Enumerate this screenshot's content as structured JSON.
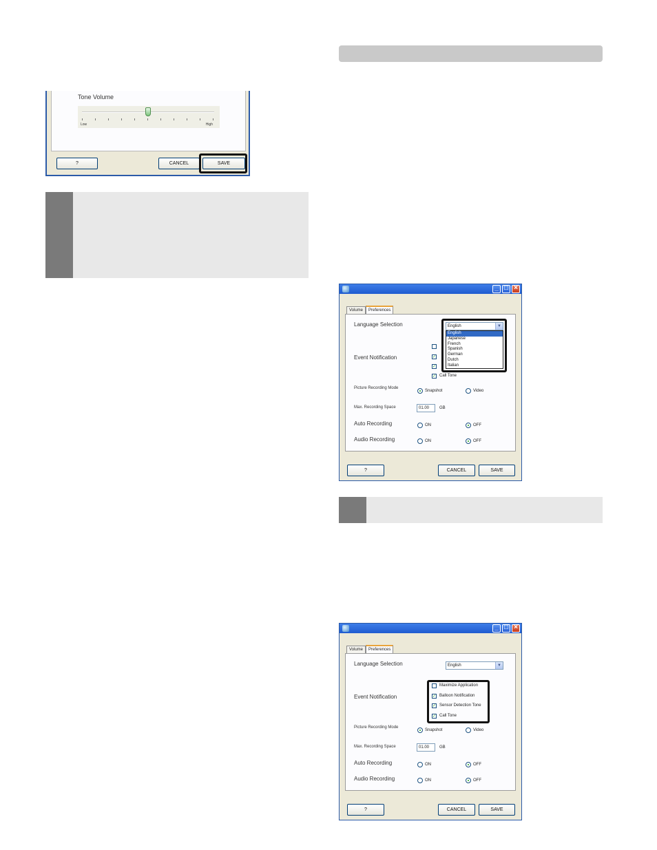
{
  "top_dialog": {
    "tone_volume_label": "Tone Volume",
    "slider_low": "Low",
    "slider_high": "High",
    "slider_level_fraction": 0.5,
    "help_button": "?",
    "cancel_button": "CANCEL",
    "save_button": "SAVE"
  },
  "dialog_tabs": {
    "volume": "Volume",
    "preferences": "Preferences"
  },
  "dialog_language": {
    "language_label": "Language Selection",
    "selected_language": "English",
    "language_options": [
      "English",
      "Japanese",
      "French",
      "Spanish",
      "German",
      "Dutch",
      "Italian"
    ],
    "event_label": "Event Notification",
    "call_tone_partial": "Call Tone",
    "picture_mode_label": "Picture Recording Mode",
    "snapshot": "Snapshot",
    "video": "Video",
    "max_space_label": "Max. Recording Space",
    "max_space_value": "01.00",
    "max_space_unit": "GB",
    "auto_recording_label": "Auto Recording",
    "audio_recording_label": "Audio Recording",
    "on": "ON",
    "off": "OFF",
    "help_button": "?",
    "cancel_button": "CANCEL",
    "save_button": "SAVE"
  },
  "dialog_events": {
    "language_label": "Language Selection",
    "selected_language": "English",
    "event_label": "Event Notification",
    "events": [
      {
        "label": "Maximize Application",
        "checked": false
      },
      {
        "label": "Balloon Notification",
        "checked": true
      },
      {
        "label": "Sensor Detection Tone",
        "checked": true
      },
      {
        "label": "Call Tone",
        "checked": true
      }
    ],
    "picture_mode_label": "Picture Recording Mode",
    "snapshot": "Snapshot",
    "video": "Video",
    "max_space_label": "Max. Recording Space",
    "max_space_value": "01.00",
    "max_space_unit": "GB",
    "auto_recording_label": "Auto Recording",
    "audio_recording_label": "Audio Recording",
    "on": "ON",
    "off": "OFF",
    "help_button": "?",
    "cancel_button": "CANCEL",
    "save_button": "SAVE"
  },
  "colors": {
    "highlight_box": "#111111",
    "check_green": "#21a121",
    "gray_bar": "#e8e8e8",
    "gray_tab": "#7a7a7a"
  }
}
